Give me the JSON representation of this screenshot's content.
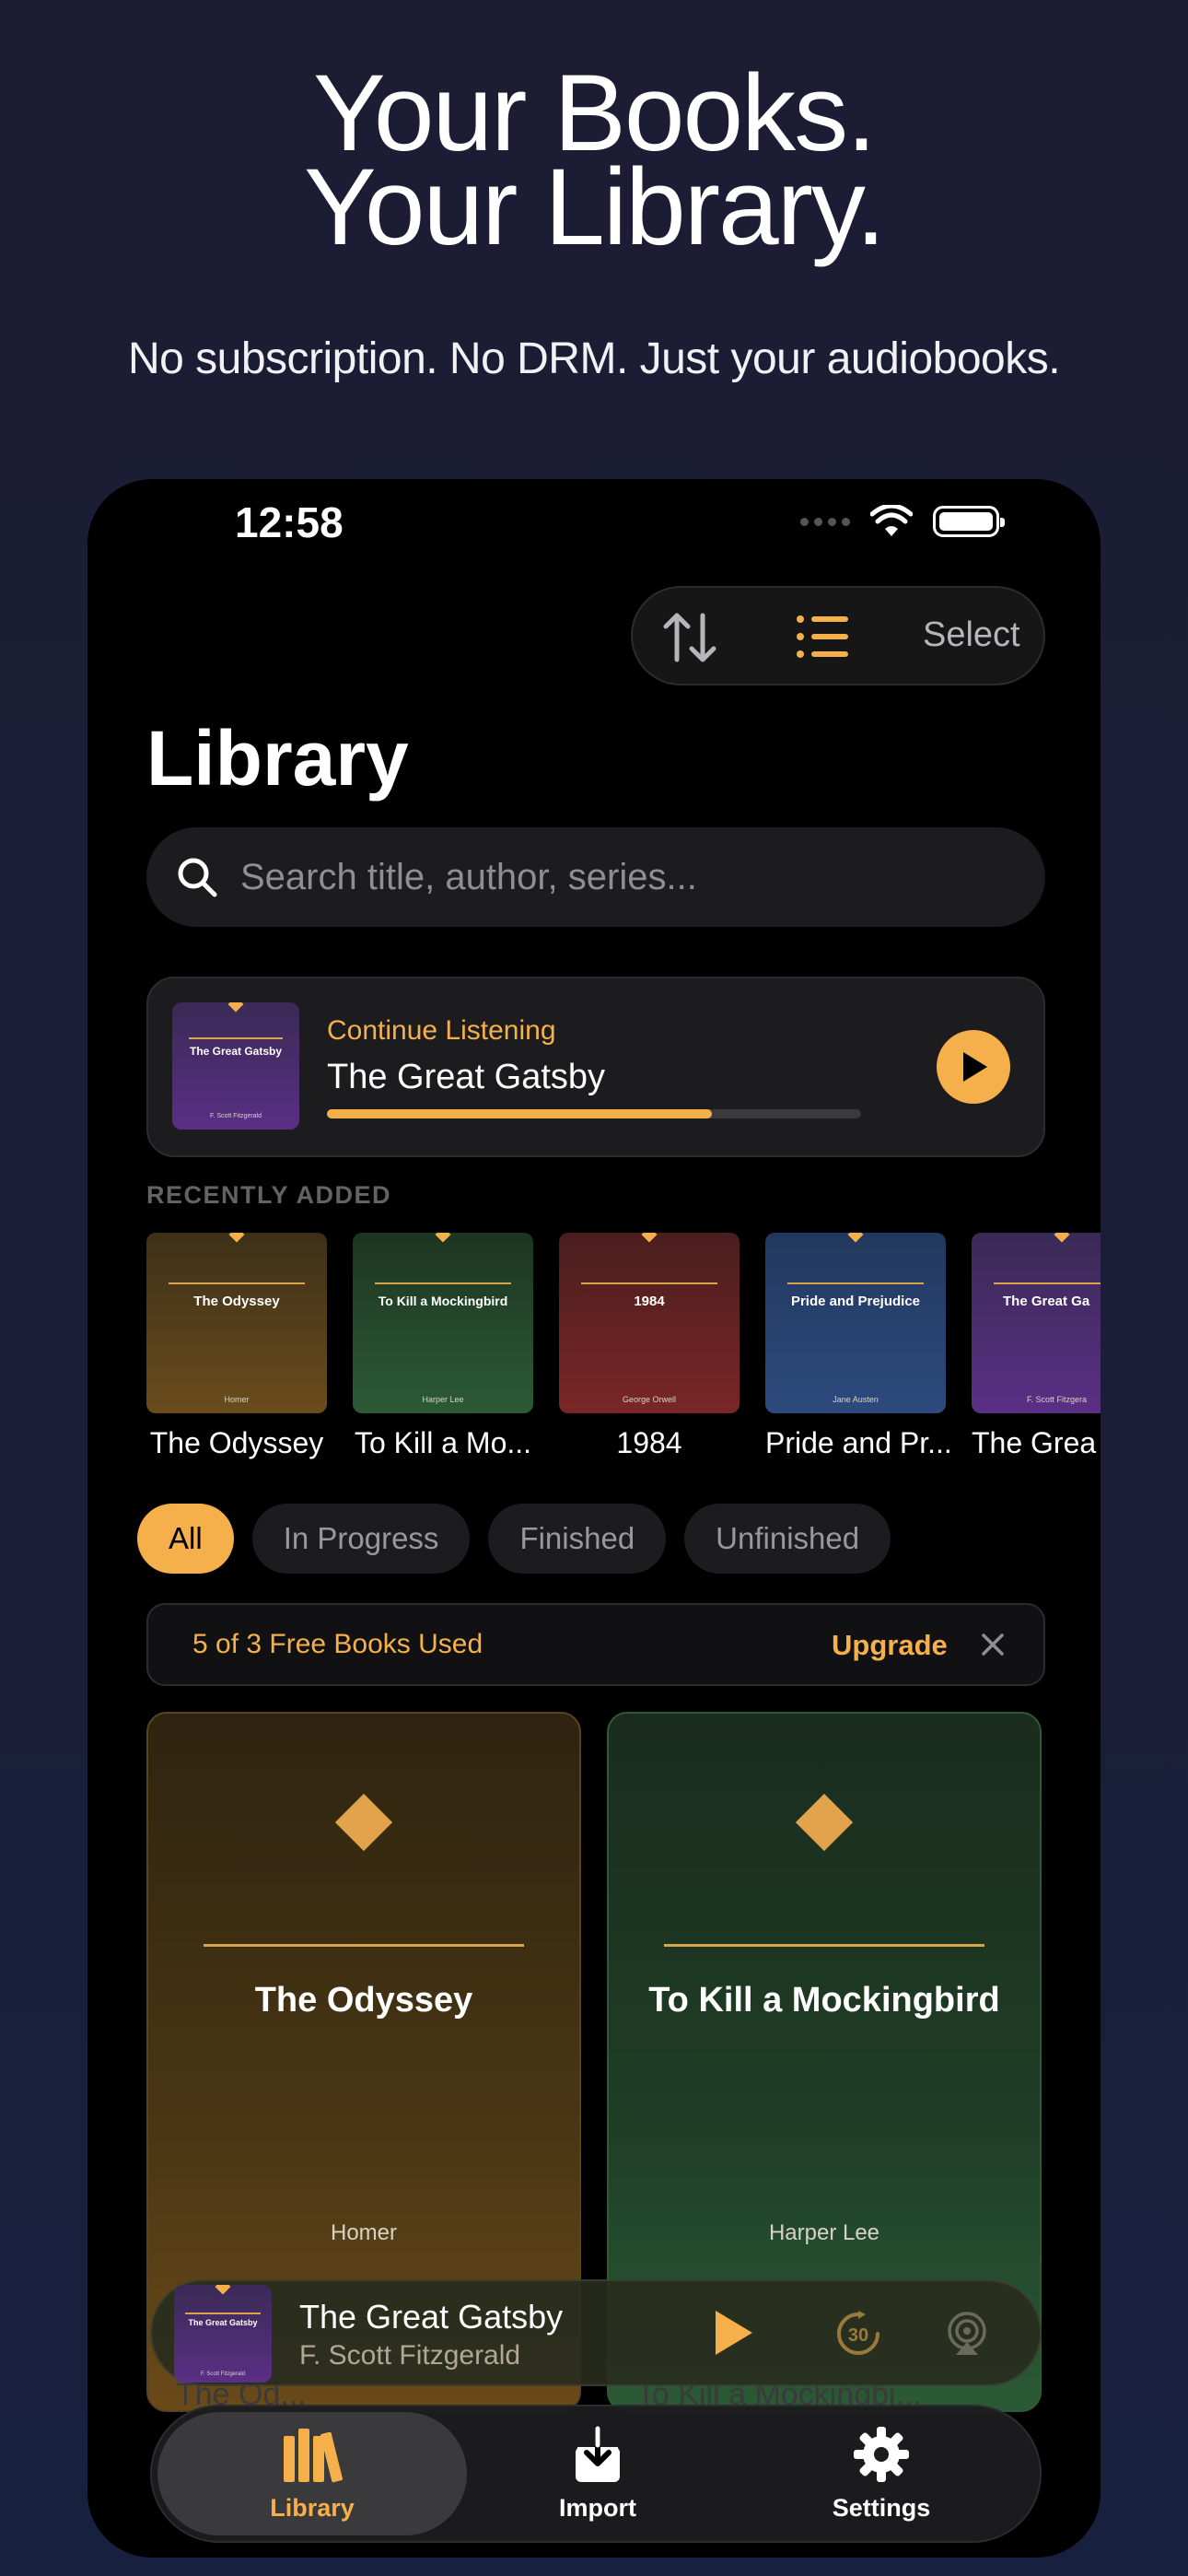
{
  "hero": {
    "title_line1": "Your Books.",
    "title_line2": "Your Library.",
    "subtitle": "No subscription. No DRM. Just your audiobooks."
  },
  "status_bar": {
    "time": "12:58"
  },
  "toolbar": {
    "select_label": "Select",
    "sort_icon": "sort-arrows-icon",
    "list_icon": "list-view-icon"
  },
  "library": {
    "title": "Library",
    "search_placeholder": "Search title, author, series..."
  },
  "continue_listening": {
    "label": "Continue Listening",
    "title": "The Great Gatsby",
    "cover_title": "The Great Gatsby",
    "cover_author": "F. Scott Fitzgerald",
    "progress": 0.72
  },
  "recently_added": {
    "label": "RECENTLY ADDED",
    "items": [
      {
        "label": "The Odyssey",
        "cover_title": "The Odyssey",
        "cover_author": "Homer"
      },
      {
        "label": "To Kill a Mo...",
        "cover_title": "To Kill a Mockingbird",
        "cover_author": "Harper Lee"
      },
      {
        "label": "1984",
        "cover_title": "1984",
        "cover_author": "George Orwell"
      },
      {
        "label": "Pride and Pr...",
        "cover_title": "Pride and Prejudice",
        "cover_author": "Jane Austen"
      },
      {
        "label": "The Grea",
        "cover_title": "The Great Ga",
        "cover_author": "F. Scott Fitzgera"
      }
    ]
  },
  "filters": {
    "items": [
      "All",
      "In Progress",
      "Finished",
      "Unfinished"
    ],
    "selected": "All"
  },
  "banner": {
    "text": "5 of 3 Free Books Used",
    "upgrade": "Upgrade"
  },
  "grid": {
    "cards": [
      {
        "title": "The Odyssey",
        "author": "Homer",
        "below": "The Od..."
      },
      {
        "title": "To Kill a Mockingbird",
        "author": "Harper Lee",
        "below": "To Kill a Mockingbi..."
      }
    ]
  },
  "mini_player": {
    "title": "The Great Gatsby",
    "author": "F. Scott Fitzgerald",
    "cover_title": "The Great Gatsby",
    "cover_author": "F. Scott Fitzgerald",
    "skip_seconds": "30"
  },
  "tabbar": {
    "items": [
      {
        "label": "Library",
        "icon": "books-icon"
      },
      {
        "label": "Import",
        "icon": "import-icon"
      },
      {
        "label": "Settings",
        "icon": "gear-icon"
      }
    ],
    "selected": "Library"
  },
  "colors": {
    "accent": "#f5b04b",
    "background_top": "#1c1d33",
    "phone_bg": "#000000",
    "odyssey": "#5a4418",
    "mockingbird": "#1e4a2a",
    "orwell": "#6b2222",
    "austen": "#26406b",
    "gatsby": "#4a2a6b"
  }
}
